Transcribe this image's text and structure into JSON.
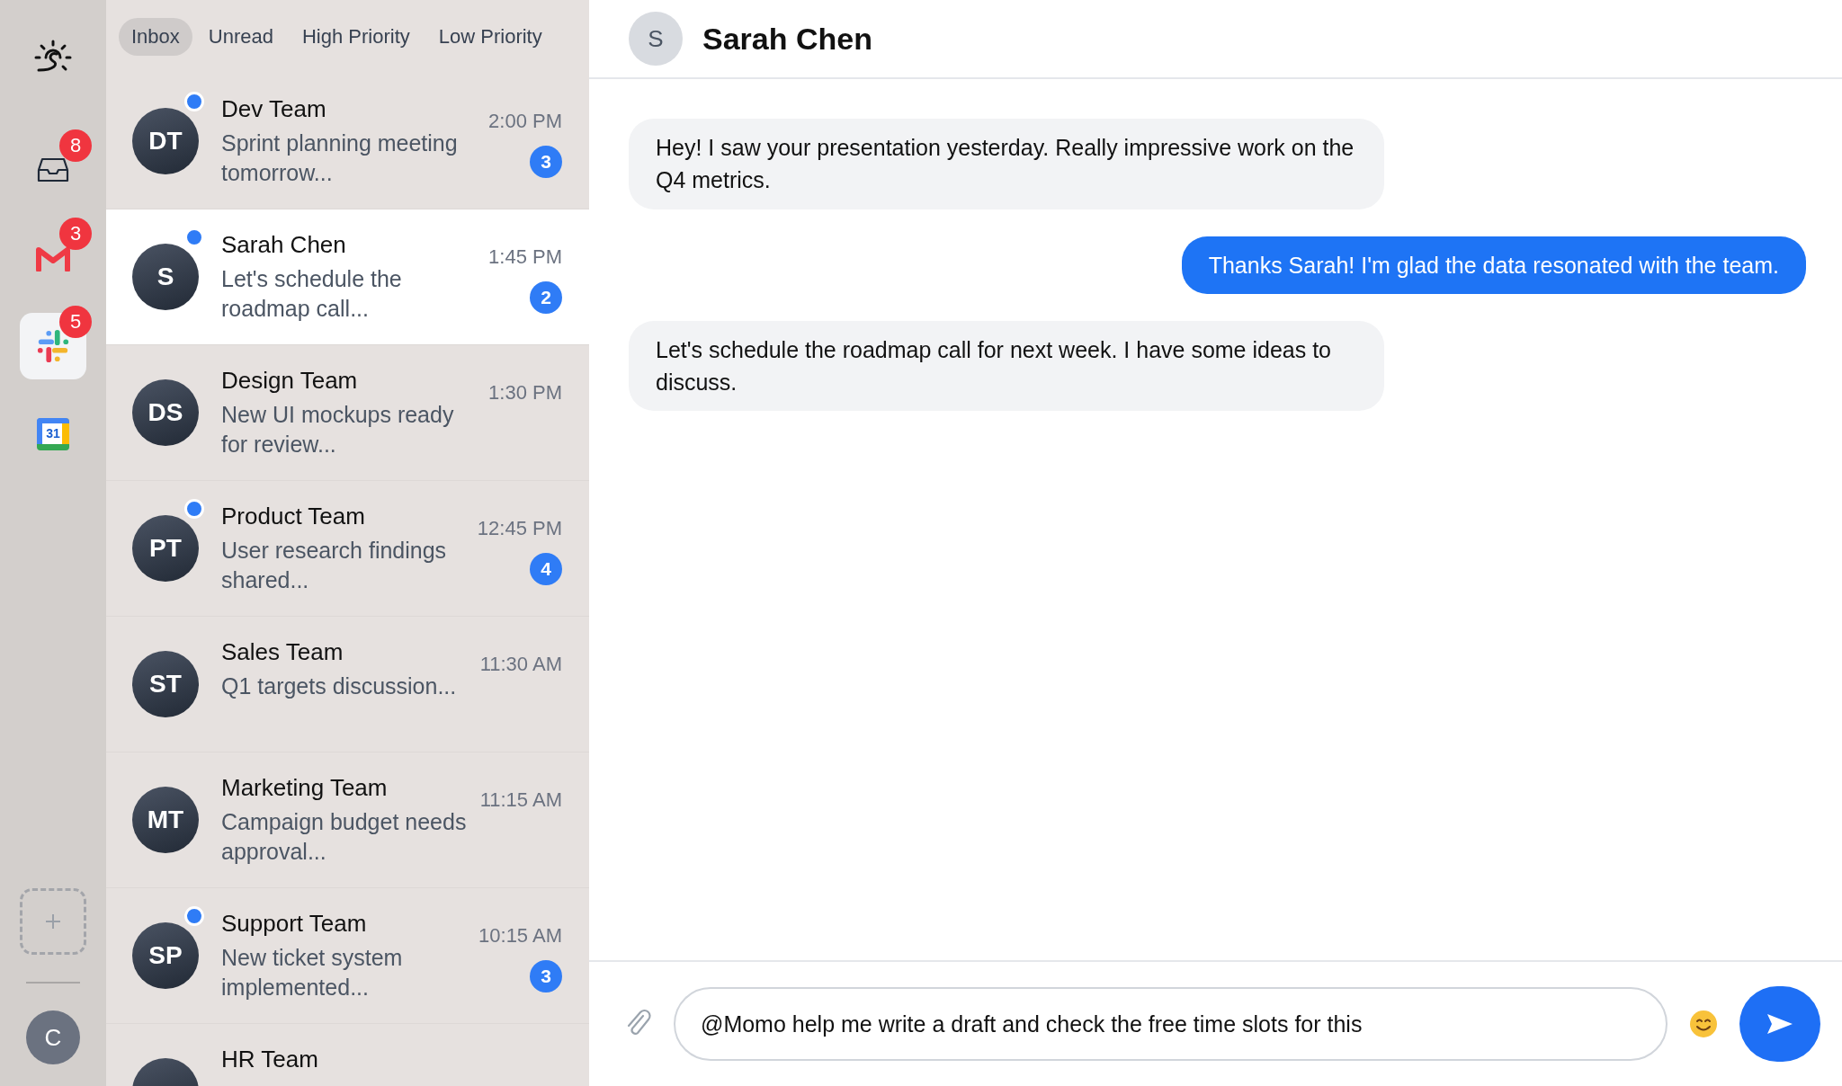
{
  "rail": {
    "apps": [
      {
        "kind": "inbox",
        "badge": "8",
        "selected": false
      },
      {
        "kind": "gmail",
        "badge": "3",
        "selected": false
      },
      {
        "kind": "slack",
        "badge": "5",
        "selected": true
      },
      {
        "kind": "calendar",
        "label": "31",
        "selected": false
      }
    ],
    "user_avatar": {
      "initial": "C"
    }
  },
  "tabs": [
    {
      "label": "Inbox",
      "selected": true
    },
    {
      "label": "Unread",
      "selected": false
    },
    {
      "label": "High Priority",
      "selected": false
    },
    {
      "label": "Low Priority",
      "selected": false
    }
  ],
  "conversations": [
    {
      "initials": "DT",
      "name": "Dev Team",
      "preview": "Sprint planning meeting tomorrow...",
      "time": "2:00 PM",
      "unread": true,
      "badge": "3",
      "selected": false
    },
    {
      "initials": "S",
      "name": "Sarah Chen",
      "preview": "Let's schedule the roadmap call...",
      "time": "1:45 PM",
      "unread": true,
      "badge": "2",
      "selected": true
    },
    {
      "initials": "DS",
      "name": "Design Team",
      "preview": "New UI mockups ready for review...",
      "time": "1:30 PM",
      "unread": false,
      "selected": false
    },
    {
      "initials": "PT",
      "name": "Product Team",
      "preview": "User research findings shared...",
      "time": "12:45 PM",
      "unread": true,
      "badge": "4",
      "selected": false
    },
    {
      "initials": "ST",
      "name": "Sales Team",
      "preview": "Q1 targets discussion...",
      "time": "11:30 AM",
      "unread": false,
      "selected": false
    },
    {
      "initials": "MT",
      "name": "Marketing Team",
      "preview": "Campaign budget needs approval...",
      "time": "11:15 AM",
      "unread": false,
      "selected": false
    },
    {
      "initials": "SP",
      "name": "Support Team",
      "preview": "New ticket system implemented...",
      "time": "10:15 AM",
      "unread": true,
      "badge": "3",
      "selected": false
    },
    {
      "name": "HR Team",
      "unread": false,
      "selected": false
    }
  ],
  "chat": {
    "contact": {
      "initial": "S",
      "name": "Sarah Chen"
    },
    "messages": [
      {
        "kind": "incoming",
        "text": "Hey! I saw your presentation yesterday. Really impressive work on the Q4 metrics."
      },
      {
        "kind": "outgoing",
        "text": "Thanks Sarah! I'm glad the data resonated with the team."
      },
      {
        "kind": "incoming",
        "text": "Let's schedule the roadmap call for next week. I have some ideas to discuss."
      }
    ],
    "composer": {
      "value": "@Momo help me write a draft and check the free time slots for this"
    }
  }
}
